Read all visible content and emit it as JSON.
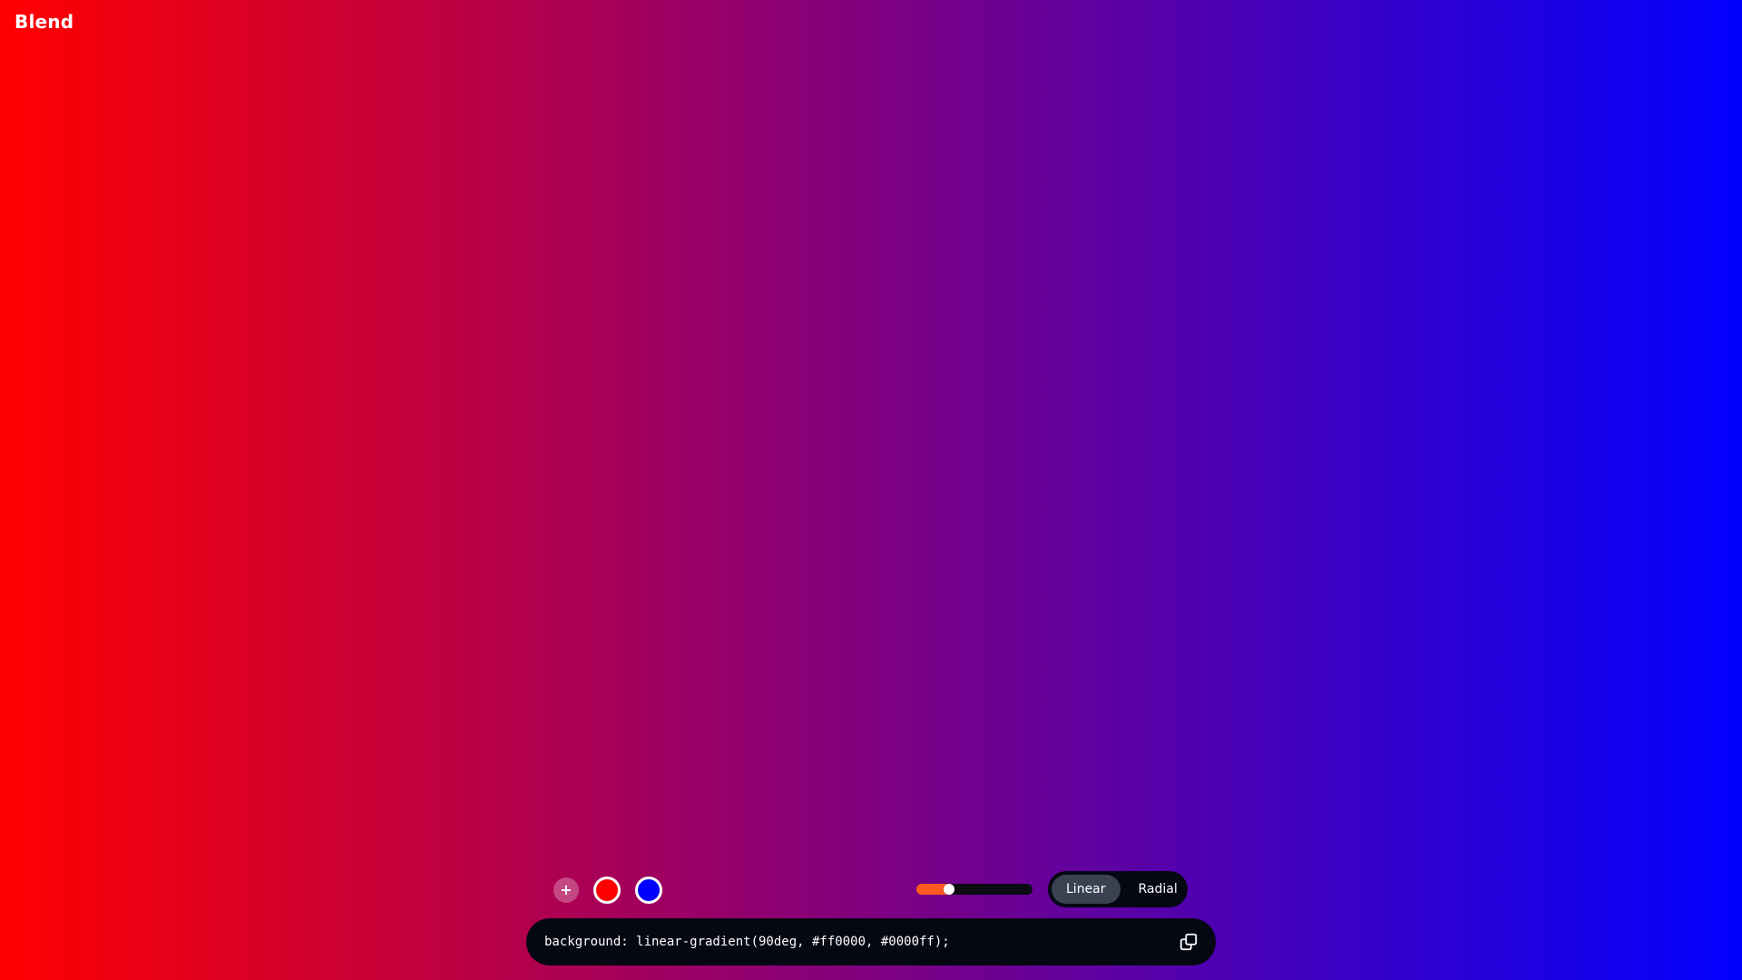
{
  "app": {
    "title": "Blend"
  },
  "stops": {
    "add_label": "+",
    "colors": [
      "#ff0000",
      "#0000ff"
    ]
  },
  "angle_slider": {
    "value_fraction": 0.28,
    "fill_color": "#ff5a1f"
  },
  "mode_toggle": {
    "options": [
      "Linear",
      "Radial"
    ],
    "selected": "Linear"
  },
  "css_output": {
    "code": "background: linear-gradient(90deg, #ff0000, #0000ff);"
  },
  "icons": {
    "copy": "copy-icon"
  },
  "colors": {
    "panel": "#050713",
    "active_option": "#3a4252"
  }
}
